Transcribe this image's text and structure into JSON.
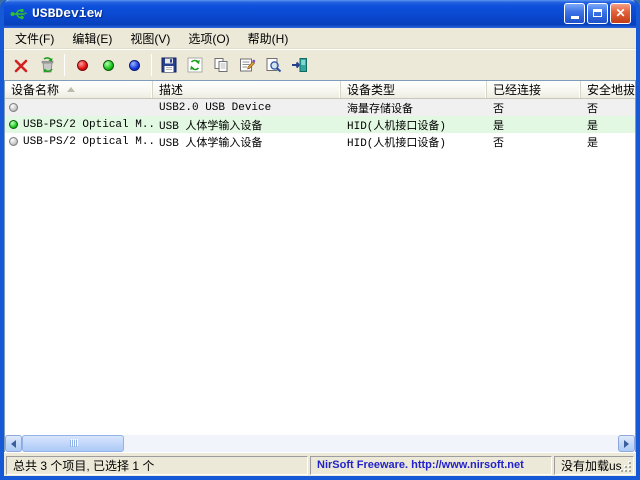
{
  "window": {
    "title": "USBDeview"
  },
  "titlebar": {
    "icons": [
      "usb-icon"
    ],
    "buttons": [
      "minimize-button",
      "maximize-button",
      "close-button"
    ]
  },
  "menu": {
    "items": [
      {
        "label": "文件(F)"
      },
      {
        "label": "编辑(E)"
      },
      {
        "label": "视图(V)"
      },
      {
        "label": "选项(O)"
      },
      {
        "label": "帮助(H)"
      }
    ]
  },
  "toolbar": {
    "buttons": [
      {
        "icon": "delete-red-x-icon"
      },
      {
        "icon": "uninstall-trash-recycle-icon"
      },
      {
        "icon": "red-ball-icon"
      },
      {
        "icon": "green-ball-icon"
      },
      {
        "icon": "blue-ball-icon"
      },
      {
        "icon": "save-floppy-icon"
      },
      {
        "icon": "refresh-icon"
      },
      {
        "icon": "copy-icon"
      },
      {
        "icon": "properties-icon"
      },
      {
        "icon": "find-icon"
      },
      {
        "icon": "exit-door-icon"
      }
    ]
  },
  "table": {
    "columns": [
      {
        "label": "设备名称",
        "sorted": "ascending"
      },
      {
        "label": "描述"
      },
      {
        "label": "设备类型"
      },
      {
        "label": "已经连接"
      },
      {
        "label": "安全地拔"
      }
    ],
    "rows": [
      {
        "status_icon": "gray-ball-icon",
        "name": "",
        "description": "USB2.0 USB Device",
        "type": "海量存储设备",
        "connected": "否",
        "safe_remove": "否",
        "state": "selected-inactive"
      },
      {
        "status_icon": "green-ball-icon",
        "name": "USB-PS/2 Optical M...",
        "description": "USB 人体学输入设备",
        "type": "HID(人机接口设备)",
        "connected": "是",
        "safe_remove": "是",
        "state": "connected"
      },
      {
        "status_icon": "gray-ball-icon",
        "name": "USB-PS/2 Optical M...",
        "description": "USB 人体学输入设备",
        "type": "HID(人机接口设备)",
        "connected": "否",
        "safe_remove": "是",
        "state": "normal"
      }
    ]
  },
  "statusbar": {
    "summary": "总共 3 个项目, 已选择 1 个",
    "branding": "NirSoft Freeware.  http://www.nirsoft.net",
    "right_status": "没有加载us"
  },
  "colors": {
    "title_gradient_main": "#0A47CE",
    "connected_row_bg": "#E2F8E2",
    "selected_inactive_row_bg": "#F0F0F0",
    "branding_text": "#2222CC",
    "chrome_bg": "#ECE9D8"
  }
}
